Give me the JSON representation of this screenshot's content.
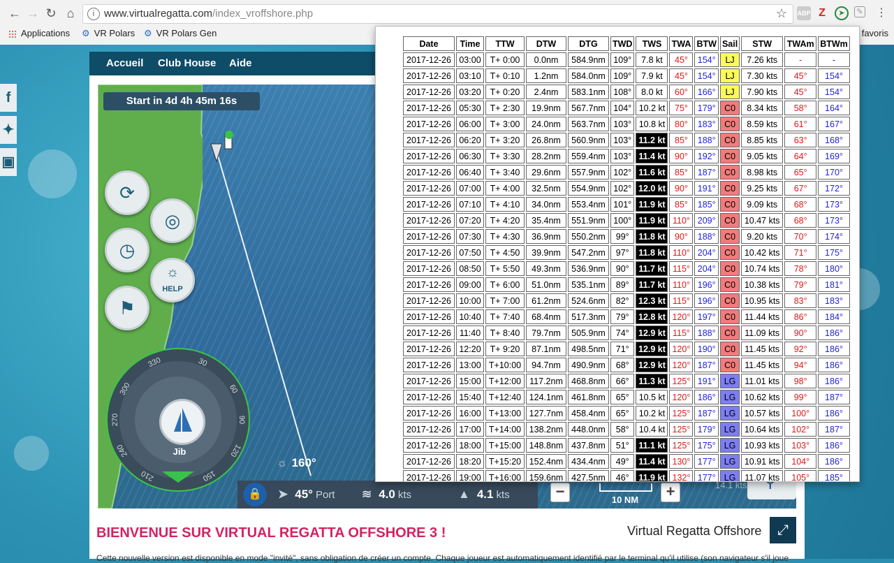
{
  "browser": {
    "url_host": "www.virtualregatta.com",
    "url_path": "/index_vroffshore.php",
    "bookmarks": [
      {
        "label": "Applications"
      },
      {
        "label": "VR Polars"
      },
      {
        "label": "VR Polars Gen"
      }
    ],
    "favoris": "favoris",
    "ext_labels": {
      "abp": "ABP",
      "z": "Z"
    }
  },
  "site": {
    "nav": [
      "Accueil",
      "Club House",
      "Aide"
    ],
    "start_banner": "Start in 4d 4h 45m 16s",
    "help_label": "HELP",
    "sail_label": "Jib",
    "heading": "160°",
    "twa": "45°",
    "twa_side": "Port",
    "wind_speed": "4.0",
    "wind_unit": "kts",
    "boat_speed": "4.1",
    "boat_unit": "kts",
    "scale": "10 NM",
    "small_speed": "14.1 kts",
    "compass_labels": [
      "330",
      "30",
      "300",
      "60",
      "270",
      "90",
      "240",
      "120",
      "210",
      "150"
    ],
    "welcome": "BIENVENUE SUR VIRTUAL REGATTA OFFSHORE 3 !",
    "vro_title": "Virtual Regatta Offshore",
    "bottom_text": "Cette nouvelle version est disponible en mode \"invité\", sans obligation de créer un compte. Chaque joueur est automatiquement identifié par le terminal qu'il utilise (son navigateur s'il joue"
  },
  "routing": {
    "headers": [
      "Date",
      "Time",
      "TTW",
      "DTW",
      "DTG",
      "TWD",
      "TWS",
      "TWA",
      "BTW",
      "Sail",
      "STW",
      "TWAm",
      "BTWm"
    ],
    "rows": [
      [
        "2017-12-26",
        "03:00",
        "T+ 0:00",
        "0.0nm",
        "584.9nm",
        "109°",
        "7.8 kt",
        "45°",
        "154°",
        "LJ",
        "7.26 kts",
        "-",
        "-"
      ],
      [
        "2017-12-26",
        "03:10",
        "T+ 0:10",
        "1.2nm",
        "584.0nm",
        "109°",
        "7.9 kt",
        "45°",
        "154°",
        "LJ",
        "7.30 kts",
        "45°",
        "154°"
      ],
      [
        "2017-12-26",
        "03:20",
        "T+ 0:20",
        "2.4nm",
        "583.1nm",
        "108°",
        "8.0 kt",
        "60°",
        "166°",
        "LJ",
        "7.90 kts",
        "45°",
        "154°"
      ],
      [
        "2017-12-26",
        "05:30",
        "T+ 2:30",
        "19.9nm",
        "567.7nm",
        "104°",
        "10.2 kt",
        "75°",
        "179°",
        "C0",
        "8.34 kts",
        "58°",
        "164°"
      ],
      [
        "2017-12-26",
        "06:00",
        "T+ 3:00",
        "24.0nm",
        "563.7nm",
        "103°",
        "10.8 kt",
        "80°",
        "183°",
        "C0",
        "8.59 kts",
        "61°",
        "167°"
      ],
      [
        "2017-12-26",
        "06:20",
        "T+ 3:20",
        "26.8nm",
        "560.9nm",
        "103°",
        "11.2 kt",
        "85°",
        "188°",
        "C0",
        "8.85 kts",
        "63°",
        "168°"
      ],
      [
        "2017-12-26",
        "06:30",
        "T+ 3:30",
        "28.2nm",
        "559.4nm",
        "103°",
        "11.4 kt",
        "90°",
        "192°",
        "C0",
        "9.05 kts",
        "64°",
        "169°"
      ],
      [
        "2017-12-26",
        "06:40",
        "T+ 3:40",
        "29.6nm",
        "557.9nm",
        "102°",
        "11.6 kt",
        "85°",
        "187°",
        "C0",
        "8.98 kts",
        "65°",
        "170°"
      ],
      [
        "2017-12-26",
        "07:00",
        "T+ 4:00",
        "32.5nm",
        "554.9nm",
        "102°",
        "12.0 kt",
        "90°",
        "191°",
        "C0",
        "9.25 kts",
        "67°",
        "172°"
      ],
      [
        "2017-12-26",
        "07:10",
        "T+ 4:10",
        "34.0nm",
        "553.4nm",
        "101°",
        "11.9 kt",
        "85°",
        "185°",
        "C0",
        "9.09 kts",
        "68°",
        "173°"
      ],
      [
        "2017-12-26",
        "07:20",
        "T+ 4:20",
        "35.4nm",
        "551.9nm",
        "100°",
        "11.9 kt",
        "110°",
        "209°",
        "C0",
        "10.47 kts",
        "68°",
        "173°"
      ],
      [
        "2017-12-26",
        "07:30",
        "T+ 4:30",
        "36.9nm",
        "550.2nm",
        "99°",
        "11.8 kt",
        "90°",
        "188°",
        "C0",
        "9.20 kts",
        "70°",
        "174°"
      ],
      [
        "2017-12-26",
        "07:50",
        "T+ 4:50",
        "39.9nm",
        "547.2nm",
        "97°",
        "11.8 kt",
        "110°",
        "204°",
        "C0",
        "10.42 kts",
        "71°",
        "175°"
      ],
      [
        "2017-12-26",
        "08:50",
        "T+ 5:50",
        "49.3nm",
        "536.9nm",
        "90°",
        "11.7 kt",
        "115°",
        "204°",
        "C0",
        "10.74 kts",
        "78°",
        "180°"
      ],
      [
        "2017-12-26",
        "09:00",
        "T+ 6:00",
        "51.0nm",
        "535.1nm",
        "89°",
        "11.7 kt",
        "110°",
        "196°",
        "C0",
        "10.38 kts",
        "79°",
        "181°"
      ],
      [
        "2017-12-26",
        "10:00",
        "T+ 7:00",
        "61.2nm",
        "524.6nm",
        "82°",
        "12.3 kt",
        "115°",
        "196°",
        "C0",
        "10.95 kts",
        "83°",
        "183°"
      ],
      [
        "2017-12-26",
        "10:40",
        "T+ 7:40",
        "68.4nm",
        "517.3nm",
        "79°",
        "12.8 kt",
        "120°",
        "197°",
        "C0",
        "11.44 kts",
        "86°",
        "184°"
      ],
      [
        "2017-12-26",
        "11:40",
        "T+ 8:40",
        "79.7nm",
        "505.9nm",
        "74°",
        "12.9 kt",
        "115°",
        "188°",
        "C0",
        "11.09 kts",
        "90°",
        "186°"
      ],
      [
        "2017-12-26",
        "12:20",
        "T+ 9:20",
        "87.1nm",
        "498.5nm",
        "71°",
        "12.9 kt",
        "120°",
        "190°",
        "C0",
        "11.45 kts",
        "92°",
        "186°"
      ],
      [
        "2017-12-26",
        "13:00",
        "T+10:00",
        "94.7nm",
        "490.9nm",
        "68°",
        "12.9 kt",
        "120°",
        "187°",
        "C0",
        "11.45 kts",
        "94°",
        "186°"
      ],
      [
        "2017-12-26",
        "15:00",
        "T+12:00",
        "117.2nm",
        "468.8nm",
        "66°",
        "11.3 kt",
        "125°",
        "191°",
        "LG",
        "11.01 kts",
        "98°",
        "186°"
      ],
      [
        "2017-12-26",
        "15:40",
        "T+12:40",
        "124.1nm",
        "461.8nm",
        "65°",
        "10.5 kt",
        "120°",
        "186°",
        "LG",
        "10.62 kts",
        "99°",
        "187°"
      ],
      [
        "2017-12-26",
        "16:00",
        "T+13:00",
        "127.7nm",
        "458.4nm",
        "65°",
        "10.2 kt",
        "125°",
        "187°",
        "LG",
        "10.57 kts",
        "100°",
        "186°"
      ],
      [
        "2017-12-26",
        "17:00",
        "T+14:00",
        "138.2nm",
        "448.0nm",
        "58°",
        "10.4 kt",
        "125°",
        "179°",
        "LG",
        "10.64 kts",
        "102°",
        "187°"
      ],
      [
        "2017-12-26",
        "18:00",
        "T+15:00",
        "148.8nm",
        "437.8nm",
        "51°",
        "11.1 kt",
        "125°",
        "175°",
        "LG",
        "10.93 kts",
        "103°",
        "186°"
      ],
      [
        "2017-12-26",
        "18:20",
        "T+15:20",
        "152.4nm",
        "434.4nm",
        "49°",
        "11.4 kt",
        "130°",
        "177°",
        "LG",
        "10.91 kts",
        "104°",
        "186°"
      ],
      [
        "2017-12-26",
        "19:00",
        "T+16:00",
        "159.6nm",
        "427.5nm",
        "46°",
        "11.9 kt",
        "132°",
        "177°",
        "LG",
        "11.07 kts",
        "105°",
        "185°"
      ]
    ],
    "tws_highlight_from": 11.0,
    "colors": {
      "twa": "#e01818",
      "btw": "#2222dd",
      "LJ": "#fafa5a",
      "C0": "#f27b7b",
      "LG": "#7d7df5"
    }
  }
}
